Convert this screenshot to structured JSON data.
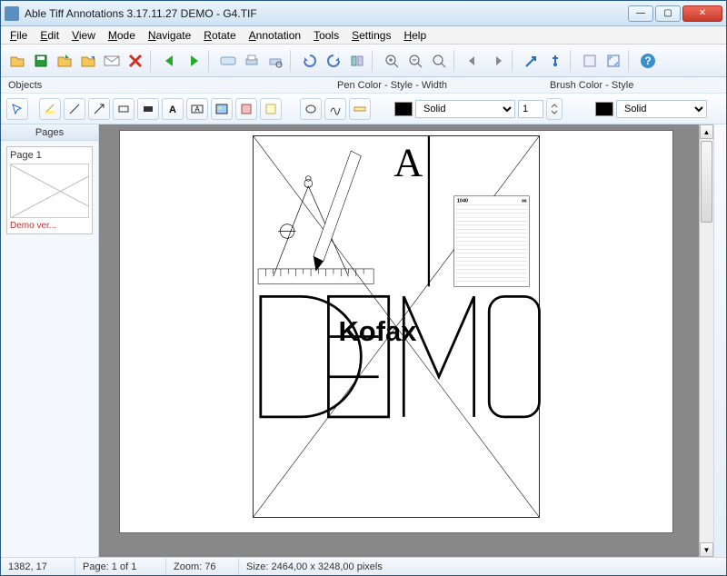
{
  "window": {
    "title": "Able Tiff Annotations 3.17.11.27 DEMO  - G4.TIF"
  },
  "menu": {
    "file": "File",
    "edit": "Edit",
    "view": "View",
    "mode": "Mode",
    "navigate": "Navigate",
    "rotate": "Rotate",
    "annotation": "Annotation",
    "tools": "Tools",
    "settings": "Settings",
    "help": "Help"
  },
  "sublabels": {
    "objects": "Objects",
    "pen": "Pen Color - Style - Width",
    "brush": "Brush Color - Style"
  },
  "pen": {
    "style": "Solid",
    "width": "1"
  },
  "brush": {
    "style": "Solid"
  },
  "pages": {
    "header": "Pages",
    "thumb_title": "Page 1",
    "demo_text": "Demo ver..."
  },
  "document": {
    "big_letter": "A",
    "kofax": "Kofax",
    "form_number": "1040",
    "form_year": "86"
  },
  "status": {
    "coord": "1382, 17",
    "page": "Page: 1 of 1",
    "zoom": "Zoom: 76",
    "size": "Size: 2464,00 x 3248,00 pixels"
  }
}
